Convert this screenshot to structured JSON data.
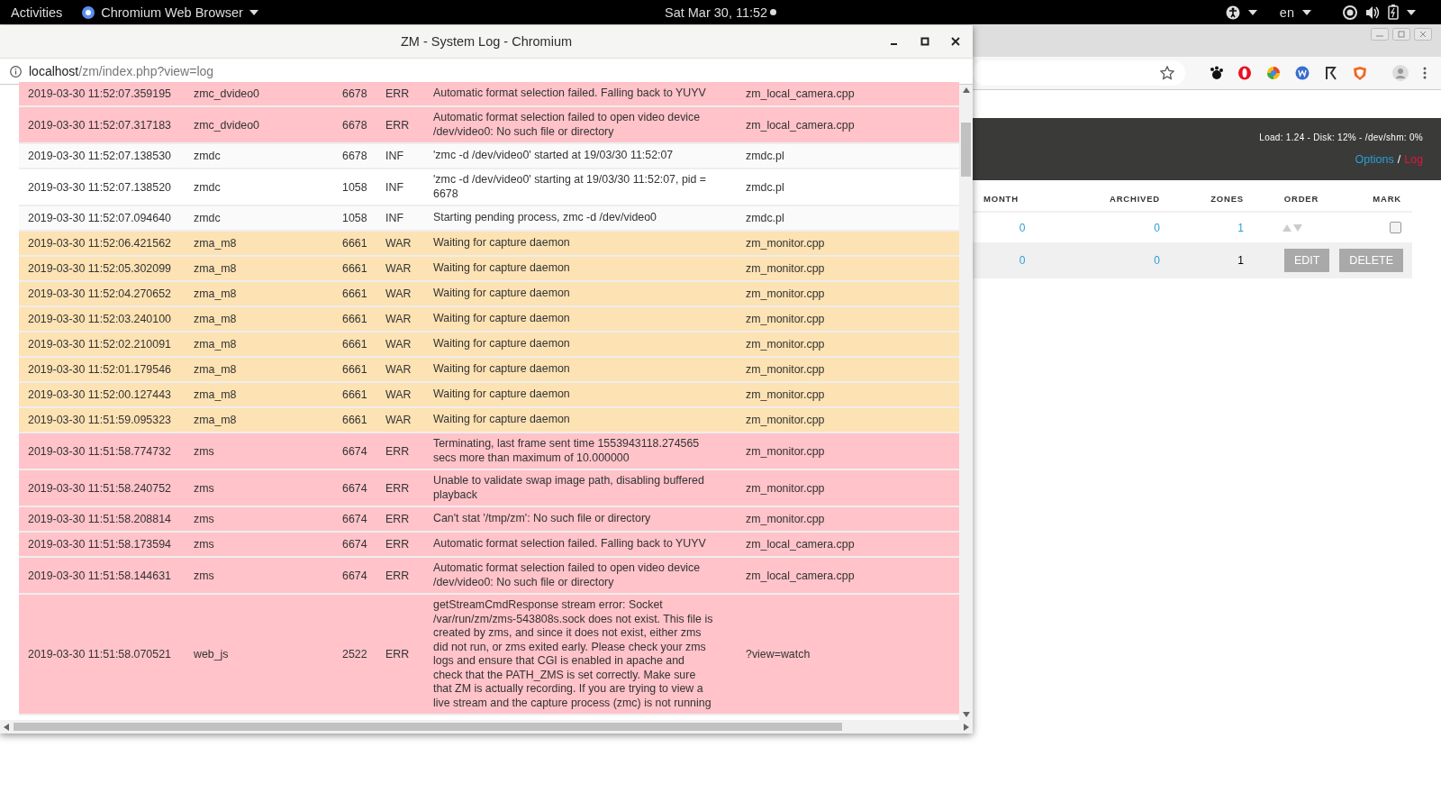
{
  "top_bar": {
    "activities": "Activities",
    "app": "Chromium Web Browser",
    "clock": "Sat Mar 30, 11:52",
    "language": "en"
  },
  "background_browser": {
    "stats": "Load: 1.24 - Disk: 12% - /dev/shm: 0%",
    "links": [
      {
        "label": "Options",
        "selected": false
      },
      {
        "label": "Log",
        "selected": true
      }
    ],
    "separator": "/",
    "columns": [
      "MONTH",
      "ARCHIVED",
      "ZONES",
      "ORDER",
      "MARK"
    ],
    "rows": [
      {
        "kind": "monitor",
        "month": "0",
        "archived": "0",
        "zones": "1",
        "checked": false
      },
      {
        "kind": "totals",
        "month": "0",
        "archived": "0",
        "zones": "1",
        "buttons": [
          "EDIT",
          "DELETE"
        ]
      }
    ]
  },
  "popup": {
    "title": "ZM - System Log - Chromium",
    "url_host": "localhost",
    "url_path": "/zm/index.php?view=log",
    "log": [
      {
        "kind": "error",
        "time": "2019-03-30 11:52:07.359195",
        "component": "zmc_dvideo0",
        "pid": "6678",
        "level": "ERR",
        "message": "Automatic format selection failed. Falling back to YUYV",
        "file": "zm_local_camera.cpp"
      },
      {
        "kind": "error",
        "time": "2019-03-30 11:52:07.317183",
        "component": "zmc_dvideo0",
        "pid": "6678",
        "level": "ERR",
        "message": "Automatic format selection failed to open video device /dev/video0: No such file or directory",
        "file": "zm_local_camera.cpp"
      },
      {
        "kind": "info",
        "time": "2019-03-30 11:52:07.138530",
        "component": "zmdc",
        "pid": "6678",
        "level": "INF",
        "message": "'zmc -d /dev/video0' started at 19/03/30 11:52:07",
        "file": "zmdc.pl"
      },
      {
        "kind": "info",
        "time": "2019-03-30 11:52:07.138520",
        "component": "zmdc",
        "pid": "1058",
        "level": "INF",
        "message": "'zmc -d /dev/video0' starting at 19/03/30 11:52:07, pid = 6678",
        "file": "zmdc.pl"
      },
      {
        "kind": "info",
        "time": "2019-03-30 11:52:07.094640",
        "component": "zmdc",
        "pid": "1058",
        "level": "INF",
        "message": "Starting pending process, zmc -d /dev/video0",
        "file": "zmdc.pl"
      },
      {
        "kind": "warning",
        "time": "2019-03-30 11:52:06.421562",
        "component": "zma_m8",
        "pid": "6661",
        "level": "WAR",
        "message": "Waiting for capture daemon",
        "file": "zm_monitor.cpp"
      },
      {
        "kind": "warning",
        "time": "2019-03-30 11:52:05.302099",
        "component": "zma_m8",
        "pid": "6661",
        "level": "WAR",
        "message": "Waiting for capture daemon",
        "file": "zm_monitor.cpp"
      },
      {
        "kind": "warning",
        "time": "2019-03-30 11:52:04.270652",
        "component": "zma_m8",
        "pid": "6661",
        "level": "WAR",
        "message": "Waiting for capture daemon",
        "file": "zm_monitor.cpp"
      },
      {
        "kind": "warning",
        "time": "2019-03-30 11:52:03.240100",
        "component": "zma_m8",
        "pid": "6661",
        "level": "WAR",
        "message": "Waiting for capture daemon",
        "file": "zm_monitor.cpp"
      },
      {
        "kind": "warning",
        "time": "2019-03-30 11:52:02.210091",
        "component": "zma_m8",
        "pid": "6661",
        "level": "WAR",
        "message": "Waiting for capture daemon",
        "file": "zm_monitor.cpp"
      },
      {
        "kind": "warning",
        "time": "2019-03-30 11:52:01.179546",
        "component": "zma_m8",
        "pid": "6661",
        "level": "WAR",
        "message": "Waiting for capture daemon",
        "file": "zm_monitor.cpp"
      },
      {
        "kind": "warning",
        "time": "2019-03-30 11:52:00.127443",
        "component": "zma_m8",
        "pid": "6661",
        "level": "WAR",
        "message": "Waiting for capture daemon",
        "file": "zm_monitor.cpp"
      },
      {
        "kind": "warning",
        "time": "2019-03-30 11:51:59.095323",
        "component": "zma_m8",
        "pid": "6661",
        "level": "WAR",
        "message": "Waiting for capture daemon",
        "file": "zm_monitor.cpp"
      },
      {
        "kind": "error",
        "time": "2019-03-30 11:51:58.774732",
        "component": "zms",
        "pid": "6674",
        "level": "ERR",
        "message": "Terminating, last frame sent time 1553943118.274565 secs more than maximum of 10.000000",
        "file": "zm_monitor.cpp"
      },
      {
        "kind": "error",
        "time": "2019-03-30 11:51:58.240752",
        "component": "zms",
        "pid": "6674",
        "level": "ERR",
        "message": "Unable to validate swap image path, disabling buffered playback",
        "file": "zm_monitor.cpp"
      },
      {
        "kind": "error",
        "time": "2019-03-30 11:51:58.208814",
        "component": "zms",
        "pid": "6674",
        "level": "ERR",
        "message": "Can't stat '/tmp/zm': No such file or directory",
        "file": "zm_monitor.cpp"
      },
      {
        "kind": "error",
        "time": "2019-03-30 11:51:58.173594",
        "component": "zms",
        "pid": "6674",
        "level": "ERR",
        "message": "Automatic format selection failed. Falling back to YUYV",
        "file": "zm_local_camera.cpp"
      },
      {
        "kind": "error",
        "time": "2019-03-30 11:51:58.144631",
        "component": "zms",
        "pid": "6674",
        "level": "ERR",
        "message": "Automatic format selection failed to open video device /dev/video0: No such file or directory",
        "file": "zm_local_camera.cpp"
      },
      {
        "kind": "error",
        "time": "2019-03-30 11:51:58.070521",
        "component": "web_js",
        "pid": "2522",
        "level": "ERR",
        "message": "getStreamCmdResponse stream error: Socket /var/run/zm/zms-543808s.sock does not exist. This file is created by zms, and since it does not exist, either zms did not run, or zms exited early. Please check your zms logs and ensure that CGI is enabled in apache and check that the PATH_ZMS is set correctly. Make sure that ZM is actually recording. If you are trying to view a live stream and the capture process (zmc) is not running",
        "file": "?view=watch"
      }
    ]
  }
}
